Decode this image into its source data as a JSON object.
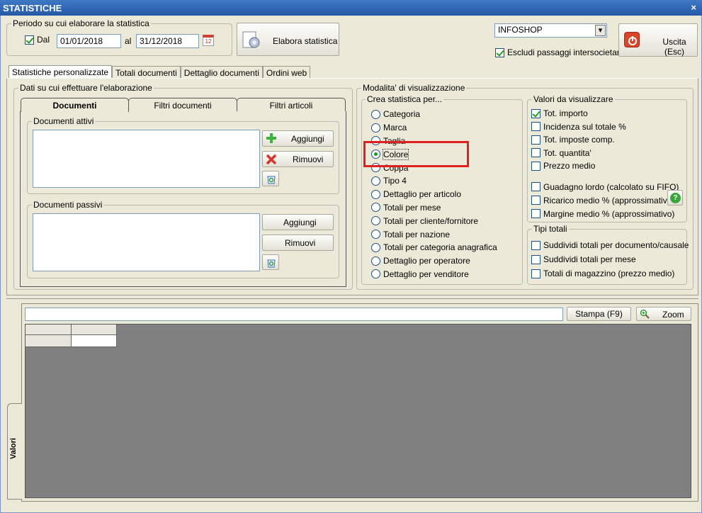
{
  "window": {
    "title": "STATISTICHE",
    "close_glyph": "×"
  },
  "period": {
    "group_title": "Periodo su cui elaborare la statistica",
    "dal_label": "Dal",
    "dal_checked": true,
    "date_from": "01/01/2018",
    "al_label": "al",
    "date_to": "31/12/2018",
    "calendar_icon": "calendar-icon",
    "calendar_day": "12"
  },
  "elabora_button": {
    "label": "Elabora statistica",
    "icon": "gear-document-icon"
  },
  "company": {
    "selected": "INFOSHOP",
    "dropdown_glyph": "▾"
  },
  "escludi": {
    "label": "Escludi passaggi intersocietari",
    "checked": true
  },
  "exit_button": {
    "label": "Uscita (Esc)",
    "icon": "power-icon",
    "color": "#d9452b"
  },
  "tabs": [
    {
      "label": "Statistiche personalizzate",
      "active": true
    },
    {
      "label": "Totali documenti",
      "active": false
    },
    {
      "label": "Dettaglio documenti",
      "active": false
    },
    {
      "label": "Ordini web",
      "active": false
    }
  ],
  "dati": {
    "group_title": "Dati su cui effettuare l'elaborazione",
    "inner_tabs": [
      {
        "label": "Documenti",
        "active": true
      },
      {
        "label": "Filtri documenti",
        "active": false
      },
      {
        "label": "Filtri articoli",
        "active": false
      }
    ],
    "attivi": {
      "title": "Documenti attivi",
      "add_label": "Aggiungi",
      "add_icon": "plus-icon",
      "remove_label": "Rimuovi",
      "remove_icon": "x-icon",
      "clear_icon": "recycle-icon"
    },
    "passivi": {
      "title": "Documenti passivi",
      "add_label": "Aggiungi",
      "remove_label": "Rimuovi",
      "clear_icon": "recycle-icon"
    }
  },
  "modalita": {
    "group_title": "Modalita' di visualizzazione",
    "crea": {
      "title": "Crea statistica per...",
      "options": [
        {
          "label": "Categoria",
          "selected": false
        },
        {
          "label": "Marca",
          "selected": false
        },
        {
          "label": "Taglia",
          "selected": false
        },
        {
          "label": "Colore",
          "selected": true
        },
        {
          "label": "Coppa",
          "selected": false
        },
        {
          "label": "Tipo 4",
          "selected": false
        },
        {
          "label": "Dettaglio per articolo",
          "selected": false
        },
        {
          "label": "Totali per mese",
          "selected": false
        },
        {
          "label": "Totali per cliente/fornitore",
          "selected": false
        },
        {
          "label": "Totali per nazione",
          "selected": false
        },
        {
          "label": "Totali per categoria anagrafica",
          "selected": false
        },
        {
          "label": "Dettaglio per operatore",
          "selected": false
        },
        {
          "label": "Dettaglio per venditore",
          "selected": false
        }
      ],
      "highlight_color": "#e0201e"
    },
    "valori": {
      "title": "Valori da visualizzare",
      "items": [
        {
          "label": "Tot. importo",
          "checked": true
        },
        {
          "label": "Incidenza sul totale %",
          "checked": false
        },
        {
          "label": "Tot. imposte comp.",
          "checked": false
        },
        {
          "label": "Tot. quantita'",
          "checked": false
        },
        {
          "label": "Prezzo medio",
          "checked": false
        },
        {
          "label": "Guadagno lordo (calcolato su FIFO)",
          "checked": false
        },
        {
          "label": "Ricarico medio % (approssimativo)",
          "checked": false
        },
        {
          "label": "Margine medio % (approssimativo)",
          "checked": false
        }
      ],
      "help_icon": "help-icon",
      "help_glyph": "?"
    },
    "tipi": {
      "title": "Tipi totali",
      "items": [
        {
          "label": "Suddividi totali per documento/causale",
          "checked": false
        },
        {
          "label": "Suddividi totali per mese",
          "checked": false
        },
        {
          "label": "Totali di magazzino (prezzo medio)",
          "checked": false
        }
      ]
    }
  },
  "results": {
    "filter_value": "",
    "print_label": "Stampa (F9)",
    "zoom_label": "Zoom",
    "zoom_icon": "zoom-icon",
    "side_tab_label": "Valori",
    "grid_bg": "#808080"
  }
}
